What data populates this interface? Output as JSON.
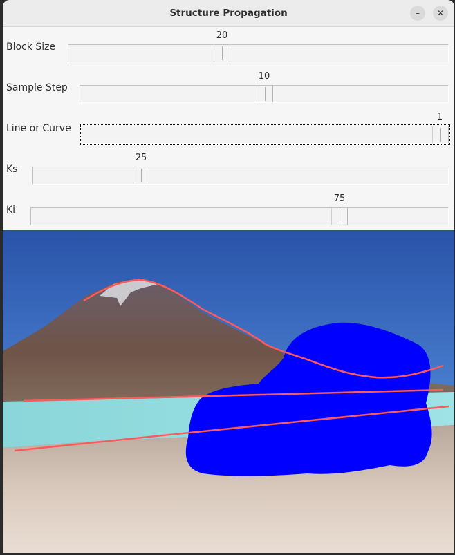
{
  "window": {
    "title": "Structure Propagation",
    "minimize_glyph": "–",
    "close_glyph": "✕"
  },
  "sliders": [
    {
      "label": "Block Size",
      "value": "20"
    },
    {
      "label": "Sample Step",
      "value": "10"
    },
    {
      "label": "Line or Curve",
      "value": "1"
    },
    {
      "label": "Ks",
      "value": "25"
    },
    {
      "label": "Ki",
      "value": "75"
    }
  ],
  "colors": {
    "mask": "#0000ff",
    "structure_line": "#ff5a5a",
    "sky": "#3d6fc4",
    "lake": "#8fdde0"
  }
}
